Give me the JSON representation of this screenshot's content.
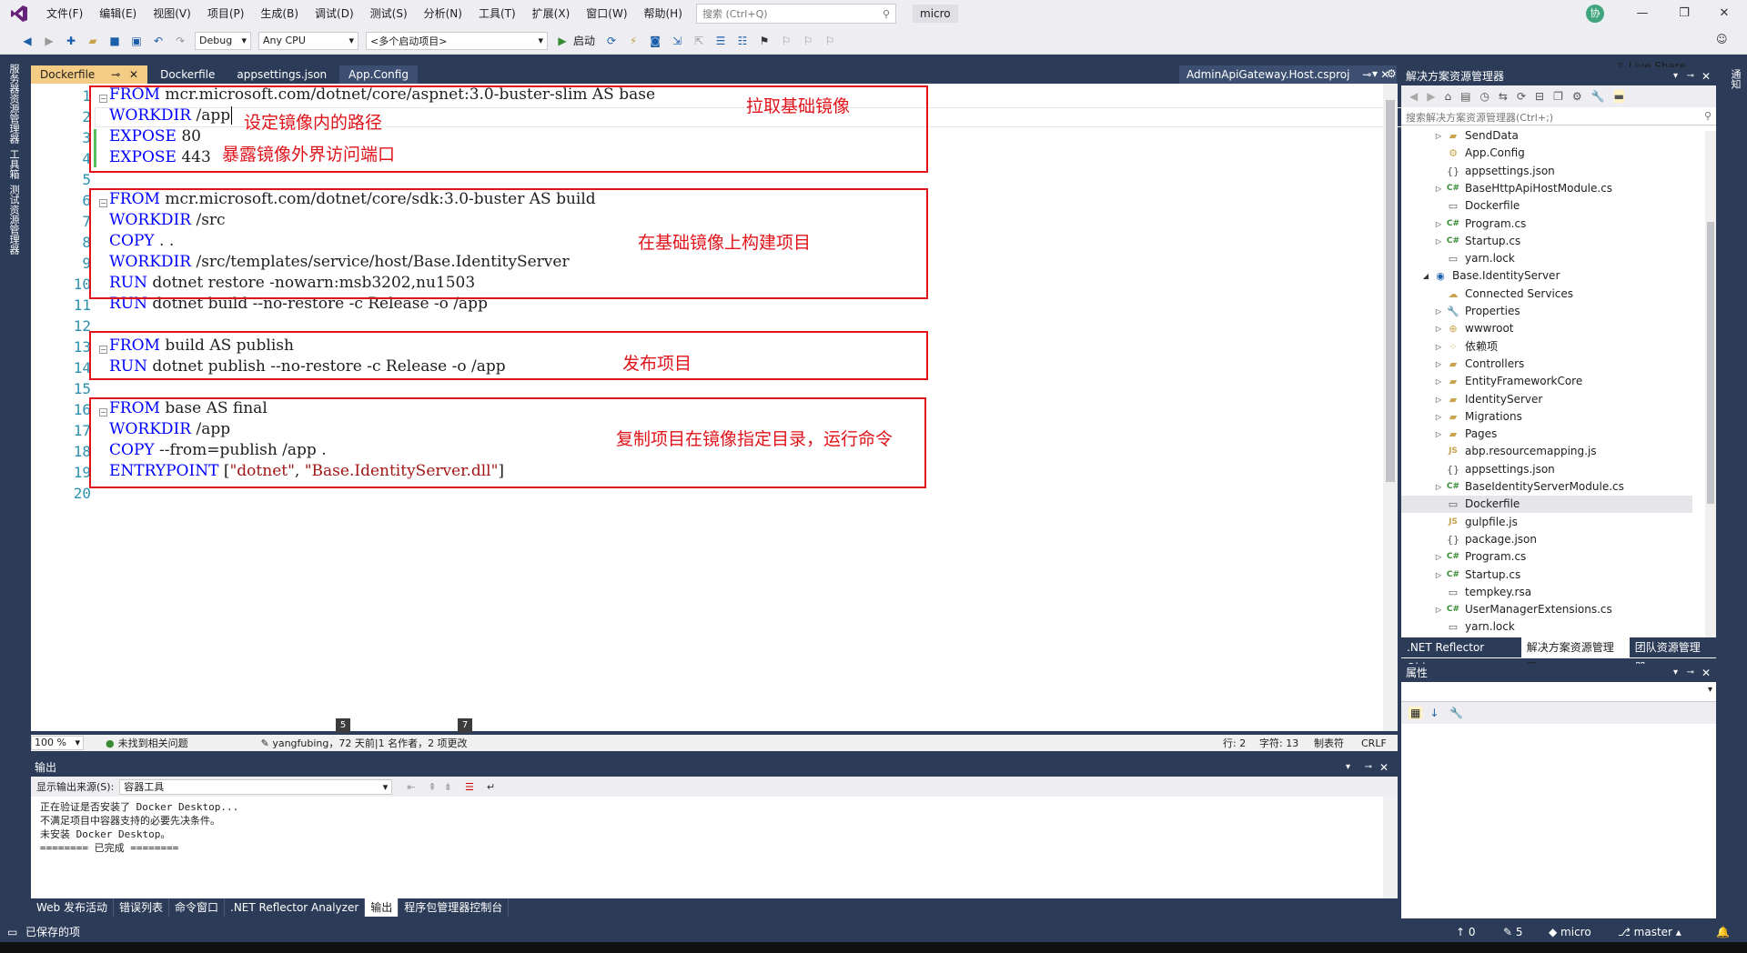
{
  "menu": {
    "items": [
      "文件(F)",
      "编辑(E)",
      "视图(V)",
      "项目(P)",
      "生成(B)",
      "调试(D)",
      "测试(S)",
      "分析(N)",
      "工具(T)",
      "扩展(X)",
      "窗口(W)",
      "帮助(H)"
    ],
    "search_placeholder": "搜索 (Ctrl+Q)",
    "solution_name": "micro",
    "avatar_letter": "协"
  },
  "toolbar": {
    "config": "Debug",
    "platform": "Any CPU",
    "startup": "<多个启动项目>",
    "start_label": "启动",
    "liveshare": "Live Share"
  },
  "left_rail": [
    "服务器资源管理器",
    "工具箱",
    "测试资源管理器"
  ],
  "doc_tabs": {
    "tabs": [
      "Dockerfile",
      "Dockerfile",
      "appsettings.json",
      "App.Config"
    ],
    "right_tab": "AdminApiGateway.Host.csproj"
  },
  "editor": {
    "line_numbers": [
      "1",
      "2",
      "3",
      "4",
      "5",
      "6",
      "7",
      "8",
      "9",
      "10",
      "11",
      "12",
      "13",
      "14",
      "15",
      "16",
      "17",
      "18",
      "19",
      "20"
    ],
    "lines": {
      "l1": {
        "kw": "FROM",
        "rest": " mcr.microsoft.com/dotnet/core/aspnet:3.0-buster-slim AS base"
      },
      "l2": {
        "kw": "WORKDIR",
        "rest": " /app"
      },
      "l3": {
        "kw": "EXPOSE",
        "rest": " 80"
      },
      "l4": {
        "kw": "EXPOSE",
        "rest": " 443"
      },
      "l6": {
        "kw": "FROM",
        "rest": " mcr.microsoft.com/dotnet/core/sdk:3.0-buster AS build"
      },
      "l7": {
        "kw": "WORKDIR",
        "rest": " /src"
      },
      "l8": {
        "kw": "COPY",
        "rest": " . ."
      },
      "l9": {
        "kw": "WORKDIR",
        "rest": " /src/templates/service/host/Base.IdentityServer"
      },
      "l10": {
        "kw": "RUN",
        "rest": " dotnet restore -nowarn:msb3202,nu1503"
      },
      "l11": {
        "kw": "RUN",
        "rest": " dotnet build --no-restore -c Release -o /app"
      },
      "l13": {
        "kw": "FROM",
        "rest": " build AS publish"
      },
      "l14": {
        "kw": "RUN",
        "rest": " dotnet publish --no-restore -c Release -o /app"
      },
      "l16": {
        "kw": "FROM",
        "rest": " base AS final"
      },
      "l17": {
        "kw": "WORKDIR",
        "rest": " /app"
      },
      "l18": {
        "kw": "COPY",
        "rest": " --from=publish /app ."
      },
      "l19": {
        "kw": "ENTRYPOINT",
        "p1": " [",
        "s1": "\"dotnet\"",
        "p2": ", ",
        "s2": "\"Base.IdentityServer.dll\"",
        "p3": "]"
      }
    },
    "annotations": {
      "a1": "拉取基础镜像",
      "a2": "设定镜像内的路径",
      "a3": "暴露镜像外界访问端口",
      "a4": "在基础镜像上构建项目",
      "a5": "发布项目",
      "a6": "复制项目在镜像指定目录，运行命令"
    },
    "annotation_color": "#e0121a"
  },
  "editor_status": {
    "zoom": "100 %",
    "issues": "未找到相关问题",
    "blame": "yangfubing，72 天前|1 名作者，2 项更改",
    "pill1": "5",
    "pill2": "7",
    "row": "行: 2",
    "col": "字符: 13",
    "tab": "制表符",
    "eol": "CRLF"
  },
  "output": {
    "title": "输出",
    "source_label": "显示输出来源(S):",
    "source_value": "容器工具",
    "lines": [
      "正在验证是否安装了 Docker Desktop...",
      "不满足项目中容器支持的必要先决条件。",
      "未安装 Docker Desktop。",
      "======== 已完成 ========"
    ]
  },
  "bottom_tabs": [
    "Web 发布活动",
    "错误列表",
    "命令窗口",
    ".NET Reflector Analyzer",
    "输出",
    "程序包管理器控制台"
  ],
  "solution_explorer": {
    "title": "解决方案资源管理器",
    "search_placeholder": "搜索解决方案资源管理器(Ctrl+;)",
    "items": [
      {
        "label": "SendData",
        "icon": "folder"
      },
      {
        "label": "App.Config",
        "icon": "config"
      },
      {
        "label": "appsettings.json",
        "icon": "json"
      },
      {
        "label": "BaseHttpApiHostModule.cs",
        "icon": "cs"
      },
      {
        "label": "Dockerfile",
        "icon": "file"
      },
      {
        "label": "Program.cs",
        "icon": "cs"
      },
      {
        "label": "Startup.cs",
        "icon": "cs"
      },
      {
        "label": "yarn.lock",
        "icon": "file"
      },
      {
        "label": "Base.IdentityServer",
        "icon": "project"
      },
      {
        "label": "Connected Services",
        "icon": "services"
      },
      {
        "label": "Properties",
        "icon": "wrench"
      },
      {
        "label": "wwwroot",
        "icon": "globe"
      },
      {
        "label": "依赖项",
        "icon": "deps"
      },
      {
        "label": "Controllers",
        "icon": "folder"
      },
      {
        "label": "EntityFrameworkCore",
        "icon": "folder"
      },
      {
        "label": "IdentityServer",
        "icon": "folder"
      },
      {
        "label": "Migrations",
        "icon": "folder"
      },
      {
        "label": "Pages",
        "icon": "folder"
      },
      {
        "label": "abp.resourcemapping.js",
        "icon": "js"
      },
      {
        "label": "appsettings.json",
        "icon": "json"
      },
      {
        "label": "BaseIdentityServerModule.cs",
        "icon": "cs"
      },
      {
        "label": "Dockerfile",
        "icon": "file"
      },
      {
        "label": "gulpfile.js",
        "icon": "js"
      },
      {
        "label": "package.json",
        "icon": "json"
      },
      {
        "label": "Program.cs",
        "icon": "cs"
      },
      {
        "label": "Startup.cs",
        "icon": "cs"
      },
      {
        "label": "tempkey.rsa",
        "icon": "file"
      },
      {
        "label": "UserManagerExtensions.cs",
        "icon": "cs"
      },
      {
        "label": "yarn.lock",
        "icon": "file"
      }
    ],
    "tabs": [
      ".NET Reflector Obj...",
      "解决方案资源管理器",
      "团队资源管理器"
    ]
  },
  "properties": {
    "title": "属性"
  },
  "right_rail": "通知",
  "statusbar": {
    "left": "已保存的项",
    "up": "0",
    "pencil": "5",
    "repo": "micro",
    "branch": "master"
  }
}
